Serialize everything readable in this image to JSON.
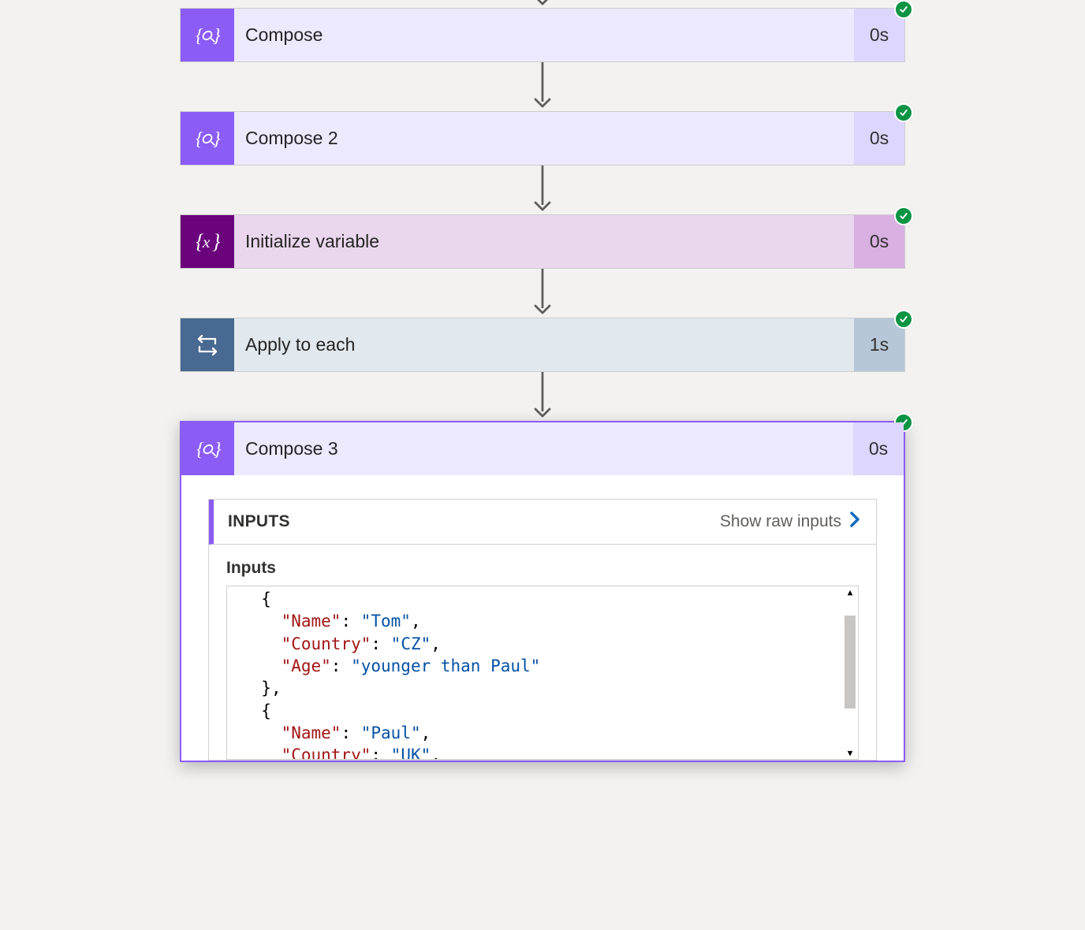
{
  "steps": [
    {
      "title": "Compose",
      "duration": "0s",
      "type": "compose"
    },
    {
      "title": "Compose 2",
      "duration": "0s",
      "type": "compose"
    },
    {
      "title": "Initialize variable",
      "duration": "0s",
      "type": "variable"
    },
    {
      "title": "Apply to each",
      "duration": "1s",
      "type": "control"
    }
  ],
  "expanded": {
    "title": "Compose 3",
    "duration": "0s",
    "inputs_header": "INPUTS",
    "raw_link": "Show raw inputs",
    "inputs_label": "Inputs",
    "json_rows": [
      {
        "indent": 1,
        "parts": [
          {
            "t": "punc",
            "v": "{"
          }
        ]
      },
      {
        "indent": 2,
        "parts": [
          {
            "t": "key",
            "v": "\"Name\""
          },
          {
            "t": "punc",
            "v": ": "
          },
          {
            "t": "str",
            "v": "\"Tom\""
          },
          {
            "t": "punc",
            "v": ","
          }
        ]
      },
      {
        "indent": 2,
        "parts": [
          {
            "t": "key",
            "v": "\"Country\""
          },
          {
            "t": "punc",
            "v": ": "
          },
          {
            "t": "str",
            "v": "\"CZ\""
          },
          {
            "t": "punc",
            "v": ","
          }
        ]
      },
      {
        "indent": 2,
        "parts": [
          {
            "t": "key",
            "v": "\"Age\""
          },
          {
            "t": "punc",
            "v": ": "
          },
          {
            "t": "str",
            "v": "\"younger than Paul\""
          }
        ]
      },
      {
        "indent": 1,
        "parts": [
          {
            "t": "punc",
            "v": "},"
          }
        ]
      },
      {
        "indent": 1,
        "parts": [
          {
            "t": "punc",
            "v": "{"
          }
        ]
      },
      {
        "indent": 2,
        "parts": [
          {
            "t": "key",
            "v": "\"Name\""
          },
          {
            "t": "punc",
            "v": ": "
          },
          {
            "t": "str",
            "v": "\"Paul\""
          },
          {
            "t": "punc",
            "v": ","
          }
        ]
      },
      {
        "indent": 2,
        "parts": [
          {
            "t": "key",
            "v": "\"Country\""
          },
          {
            "t": "punc",
            "v": ": "
          },
          {
            "t": "str",
            "v": "\"UK\""
          },
          {
            "t": "punc",
            "v": ","
          }
        ]
      }
    ]
  }
}
